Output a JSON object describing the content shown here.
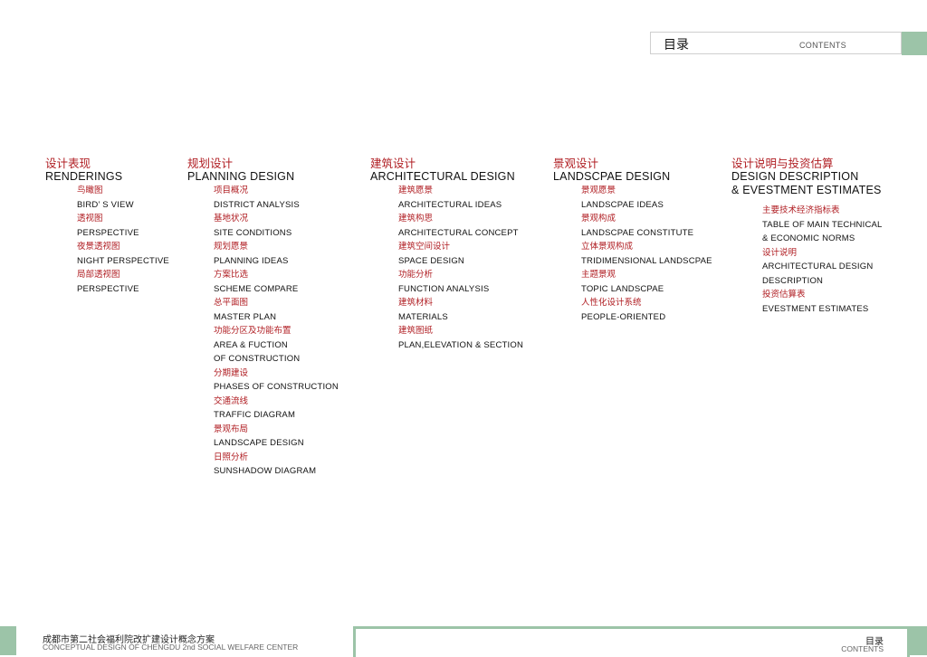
{
  "header": {
    "title_cn": "目录",
    "title_en": "CONTENTS"
  },
  "sections": [
    {
      "title_cn": "设计表现",
      "title_en": [
        "RENDERINGS"
      ],
      "items": [
        {
          "cn": "鸟瞰图",
          "en": [
            "BIRD’ S VIEW"
          ]
        },
        {
          "cn": "透视图",
          "en": [
            "PERSPECTIVE"
          ]
        },
        {
          "cn": "夜景透视图",
          "en": [
            "NIGHT PERSPECTIVE"
          ]
        },
        {
          "cn": "局部透视图",
          "en": [
            "PERSPECTIVE"
          ]
        }
      ]
    },
    {
      "title_cn": "规划设计",
      "title_en": [
        "PLANNING DESIGN"
      ],
      "items": [
        {
          "cn": "项目概况",
          "en": [
            "DISTRICT ANALYSIS"
          ]
        },
        {
          "cn": "基地状况",
          "en": [
            "SITE CONDITIONS"
          ]
        },
        {
          "cn": "规划愿景",
          "en": [
            "PLANNING IDEAS"
          ]
        },
        {
          "cn": "方案比选",
          "en": [
            "SCHEME COMPARE"
          ]
        },
        {
          "cn": "总平面图",
          "en": [
            "MASTER PLAN"
          ]
        },
        {
          "cn": "功能分区及功能布置",
          "en": [
            "AREA & FUCTION",
            "OF CONSTRUCTION"
          ]
        },
        {
          "cn": "分期建设",
          "en": [
            "PHASES OF CONSTRUCTION"
          ]
        },
        {
          "cn": "交通流线",
          "en": [
            "TRAFFIC DIAGRAM"
          ]
        },
        {
          "cn": "景观布局",
          "en": [
            "LANDSCAPE DESIGN"
          ]
        },
        {
          "cn": "日照分析",
          "en": [
            "SUNSHADOW DIAGRAM"
          ]
        }
      ]
    },
    {
      "title_cn": "建筑设计",
      "title_en": [
        "ARCHITECTURAL DESIGN"
      ],
      "items": [
        {
          "cn": "建筑愿景",
          "en": [
            "ARCHITECTURAL IDEAS"
          ]
        },
        {
          "cn": "建筑构思",
          "en": [
            "ARCHITECTURAL  CONCEPT"
          ]
        },
        {
          "cn": "建筑空间设计",
          "en": [
            "SPACE  DESIGN"
          ]
        },
        {
          "cn": "功能分析",
          "en": [
            "FUNCTION  ANALYSIS"
          ]
        },
        {
          "cn": "建筑材料",
          "en": [
            "MATERIALS"
          ]
        },
        {
          "cn": "建筑图纸",
          "en": [
            "PLAN,ELEVATION & SECTION"
          ]
        }
      ]
    },
    {
      "title_cn": "景观设计",
      "title_en": [
        "LANDSCPAE DESIGN"
      ],
      "items": [
        {
          "cn": "景观愿景",
          "en": [
            "LANDSCPAE IDEAS"
          ]
        },
        {
          "cn": "景观构成",
          "en": [
            "LANDSCPAE CONSTITUTE"
          ]
        },
        {
          "cn": "立体景观构成",
          "en": [
            "TRIDIMENSIONAL LANDSCPAE"
          ]
        },
        {
          "cn": "主题景观",
          "en": [
            "TOPIC LANDSCPAE"
          ]
        },
        {
          "cn": "人性化设计系统",
          "en": [
            "PEOPLE-ORIENTED"
          ]
        }
      ]
    },
    {
      "title_cn": "设计说明与投资估算",
      "title_en": [
        "DESIGN DESCRIPTION",
        "& EVESTMENT ESTIMATES"
      ],
      "items": [
        {
          "cn": "主要技术经济指标表",
          "en": [
            "TABLE OF MAIN TECHNICAL",
            "& ECONOMIC NORMS"
          ]
        },
        {
          "cn": "设计说明",
          "en": [
            "ARCHITECTURAL DESIGN",
            "DESCRIPTION"
          ]
        },
        {
          "cn": "投资估算表",
          "en": [
            "EVESTMENT ESTIMATES"
          ]
        }
      ]
    }
  ],
  "footer": {
    "project_cn": "成都市第二社会福利院改扩建设计概念方案",
    "project_en": "CONCEPTUAL  DESIGN  OF  CHENGDU 2nd SOCIAL WELFARE CENTER",
    "page_cn": "目录",
    "page_en": "CONTENTS"
  },
  "colors": {
    "accent_red": "#b01e23",
    "green": "#9cc4a8"
  }
}
